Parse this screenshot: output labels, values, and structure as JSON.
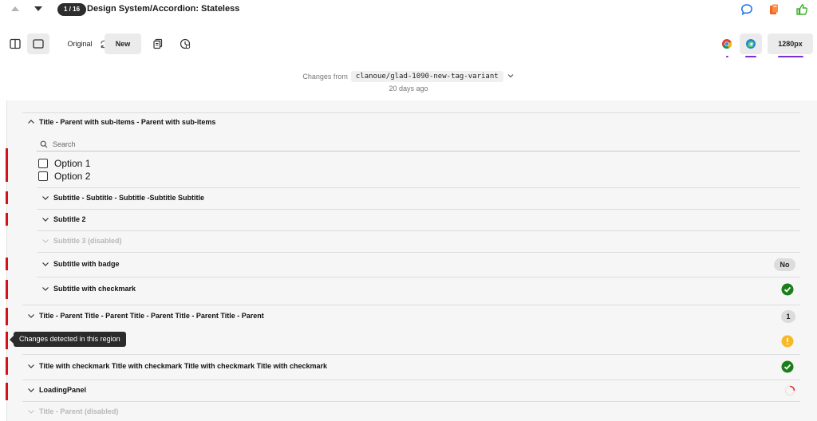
{
  "header": {
    "counter": "1 / 16",
    "title": "Design System/Accordion: Stateless",
    "icons": [
      "comment-icon",
      "book-icon",
      "thumbs-up-icon"
    ]
  },
  "toolbar": {
    "original_label": "Original",
    "new_label": "New",
    "viewport_label": "1280px",
    "icons": [
      "split-view-icon",
      "single-view-icon",
      "swap-icon",
      "copy-icon",
      "history-icon",
      "chrome-icon",
      "edge-icon"
    ]
  },
  "changes": {
    "prefix": "Changes from",
    "branch": "clanoue/glad-1090-new-tag-variant",
    "ago": "20 days ago"
  },
  "accordion": {
    "parent1_title": "Title - Parent with sub-items - Parent with sub-items",
    "search_placeholder": "Search",
    "option1": "Option 1",
    "option2": "Option 2",
    "sub1": "Subtitle - Subtitle - Subtitle -Subtitle Subtitle",
    "sub2": "Subtitle 2",
    "sub3": "Subtitle 3 (disabled)",
    "sub4": "Subtitle with badge",
    "sub4_badge": "No",
    "sub5": "Subtitle with checkmark",
    "parent2_title": "Title - Parent Title - Parent Title - Parent Title - Parent Title - Parent",
    "parent2_badge": "1",
    "parent4_title": "Title with checkmark Title with checkmark Title with checkmark Title with checkmark",
    "parent5_title": "LoadingPanel",
    "parent6_title": "Title - Parent (disabled)"
  },
  "tooltip": "Changes detected in this region",
  "colors": {
    "change_bar": "#d4111a",
    "success": "#1a7f1a",
    "warning": "#f7b928",
    "accent": "#7b2fd0",
    "comment": "#1a73e8",
    "book": "#f26522",
    "like": "#3dae2b"
  }
}
